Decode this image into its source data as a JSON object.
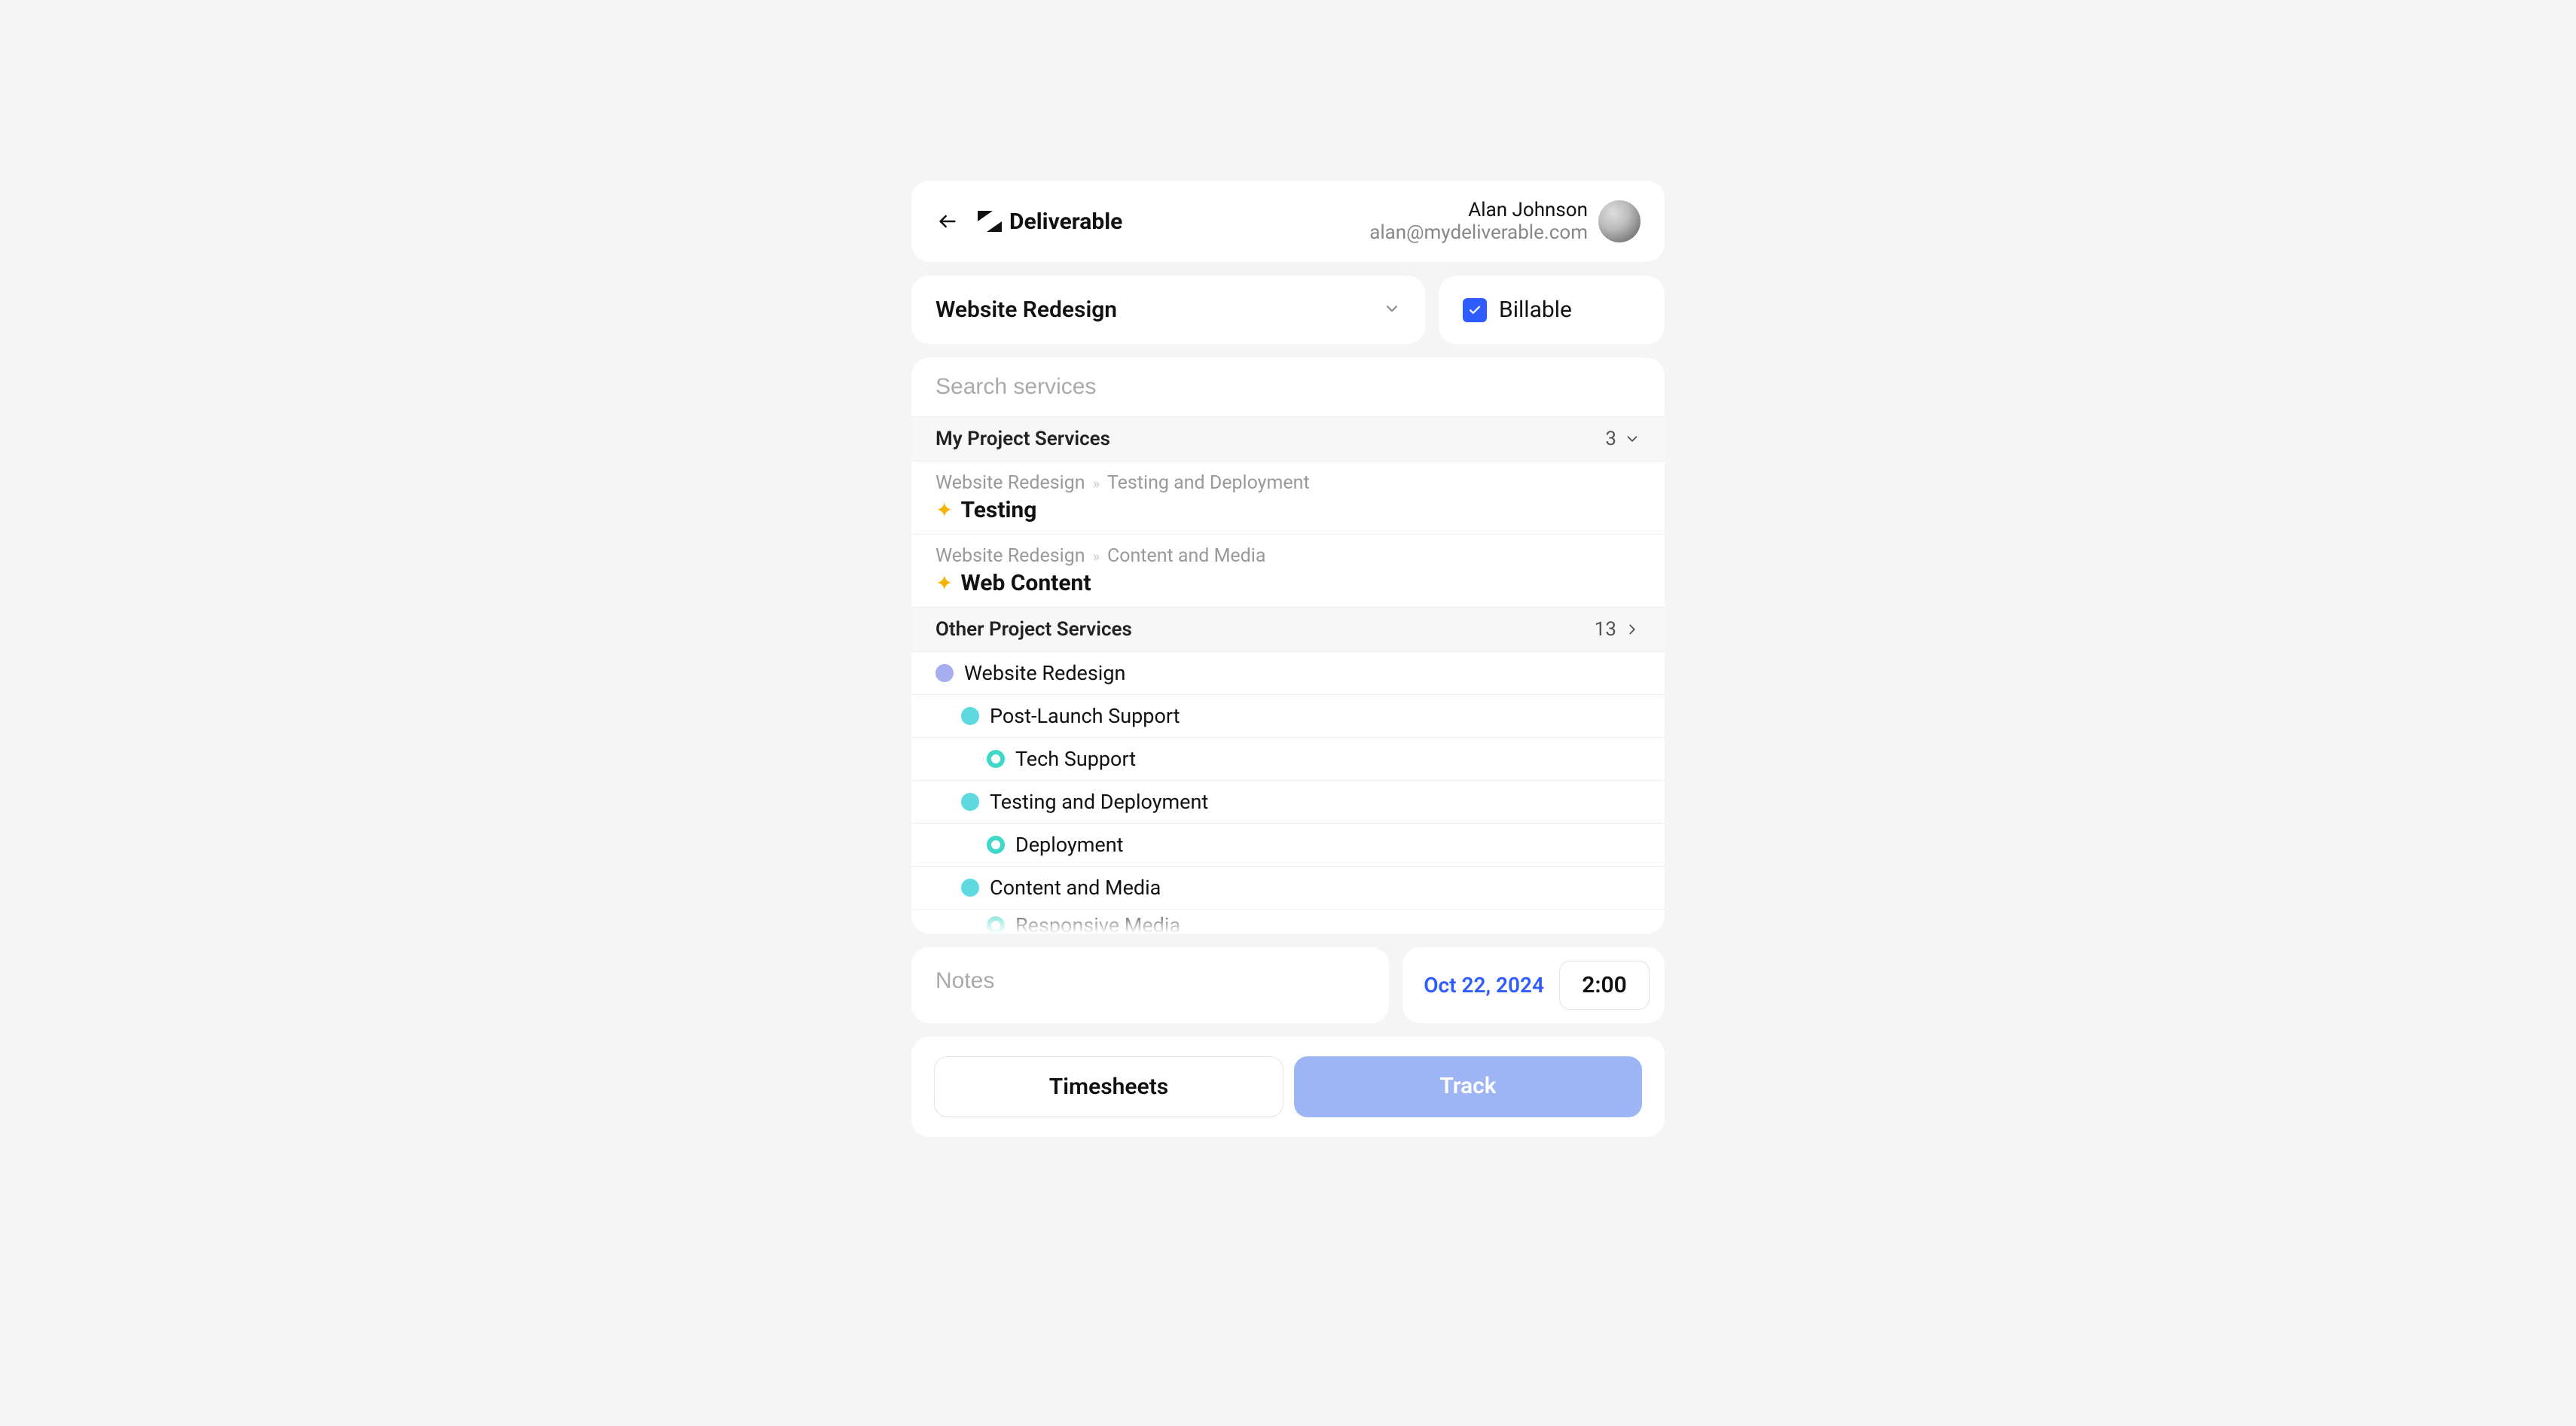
{
  "header": {
    "brand": "Deliverable",
    "user_name": "Alan Johnson",
    "user_email": "alan@mydeliverable.com"
  },
  "project": {
    "selected": "Website Redesign"
  },
  "billable": {
    "label": "Billable",
    "checked": true
  },
  "search": {
    "placeholder": "Search services"
  },
  "sections": {
    "my": {
      "title": "My Project Services",
      "count": "3"
    },
    "other": {
      "title": "Other Project Services",
      "count": "13"
    }
  },
  "my_services": [
    {
      "crumb_root": "Website Redesign",
      "crumb_leaf": "Testing and Deployment",
      "name": "Testing"
    },
    {
      "crumb_root": "Website Redesign",
      "crumb_leaf": "Content and Media",
      "name": "Web Content"
    }
  ],
  "tree": {
    "root": "Website Redesign",
    "items": [
      {
        "label": "Post-Launch Support",
        "child": "Tech Support"
      },
      {
        "label": "Testing and Deployment",
        "child": "Deployment"
      },
      {
        "label": "Content and Media",
        "child": "Responsive Media"
      }
    ]
  },
  "notes": {
    "placeholder": "Notes"
  },
  "datetime": {
    "date": "Oct 22, 2024",
    "time": "2:00"
  },
  "actions": {
    "timesheets": "Timesheets",
    "track": "Track"
  }
}
